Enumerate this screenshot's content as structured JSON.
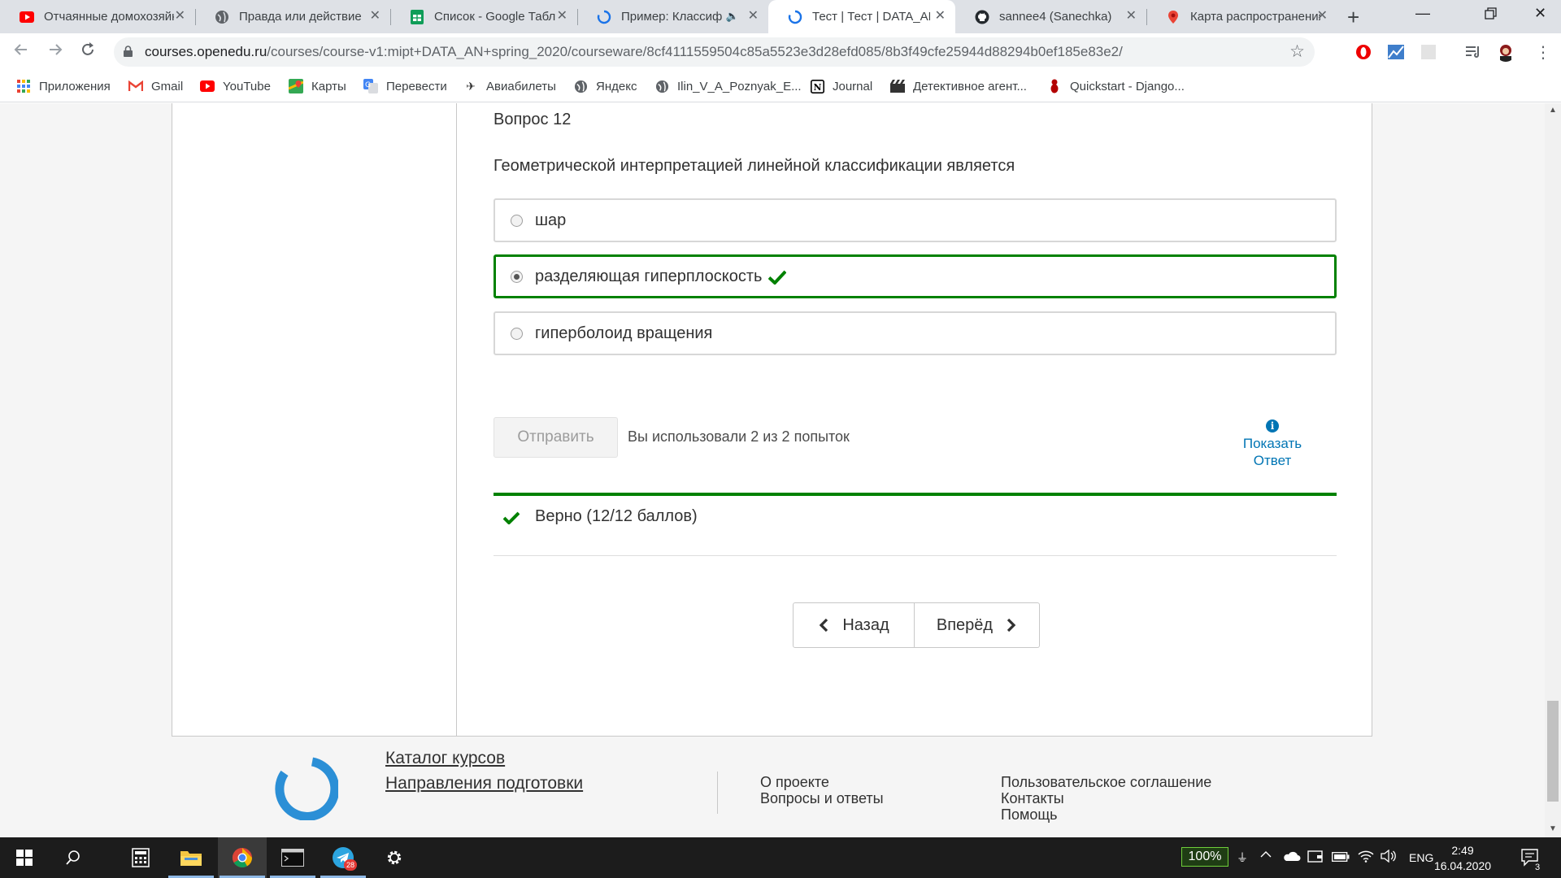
{
  "browser": {
    "tabs": [
      {
        "title": "Отчаянные домохозяйки",
        "favicon": "youtube-icon"
      },
      {
        "title": "Правда или действие",
        "favicon": "globe-icon"
      },
      {
        "title": "Список - Google Таблицы",
        "favicon": "sheets-icon"
      },
      {
        "title": "Пример: Классификация",
        "favicon": "loading-icon"
      },
      {
        "title": "Тест | Тест | DATA_AN Ск",
        "favicon": "openedu-icon"
      },
      {
        "title": "sannee4 (Sanechka)",
        "favicon": "github-icon"
      },
      {
        "title": "Карта распространения",
        "favicon": "maps-pin-icon"
      }
    ],
    "active_tab_index": 4,
    "url": {
      "host": "courses.openedu.ru",
      "path": "/courses/course-v1:mipt+DATA_AN+spring_2020/courseware/8cf4111559504c85a5523e3d28efd085/8b3f49cfe25944d88294b0ef185e83e2/"
    },
    "bookmarks": [
      {
        "label": "Приложения",
        "icon": "apps-grid-icon"
      },
      {
        "label": "Gmail",
        "icon": "gmail-icon"
      },
      {
        "label": "YouTube",
        "icon": "youtube-icon"
      },
      {
        "label": "Карты",
        "icon": "maps-icon"
      },
      {
        "label": "Перевести",
        "icon": "translate-icon"
      },
      {
        "label": "Авиабилеты",
        "icon": "plane-icon"
      },
      {
        "label": "Яндекс",
        "icon": "globe-icon"
      },
      {
        "label": "Ilin_V_A_Poznyak_E...",
        "icon": "globe-icon"
      },
      {
        "label": "Journal",
        "icon": "notion-icon"
      },
      {
        "label": "Детективное агент...",
        "icon": "film-icon"
      },
      {
        "label": "Quickstart - Django...",
        "icon": "django-icon"
      }
    ]
  },
  "problem": {
    "title": "Вопрос 12",
    "question": "Геометрической интерпретацией линейной классификации является",
    "choices": [
      {
        "label": "шар",
        "selected": false,
        "correct": false
      },
      {
        "label": "разделяющая гиперплоскость",
        "selected": true,
        "correct": true
      },
      {
        "label": "гиперболоид вращения",
        "selected": false,
        "correct": false
      }
    ],
    "submit_label": "Отправить",
    "attempts_text": "Вы использовали 2 из 2 попыток",
    "show_answer_line1": "Показать",
    "show_answer_line2": "Ответ",
    "feedback_text": "Верно (12/12 баллов)",
    "prev_label": "Назад",
    "next_label": "Вперёд"
  },
  "footer": {
    "catalog": "Каталог курсов",
    "directions": "Направления подготовки",
    "about": "О проекте",
    "faq": "Вопросы и ответы",
    "agreement": "Пользовательское соглашение",
    "contacts": "Контакты",
    "help": "Помощь"
  },
  "taskbar": {
    "battery_percent": "100%",
    "language": "ENG",
    "time": "2:49",
    "date": "16.04.2020",
    "telegram_badge": "28",
    "notifications_count": "3"
  },
  "colors": {
    "correct_green": "#008100",
    "link_blue": "#0075b4",
    "openedu_logo": "#2b8fd6"
  }
}
